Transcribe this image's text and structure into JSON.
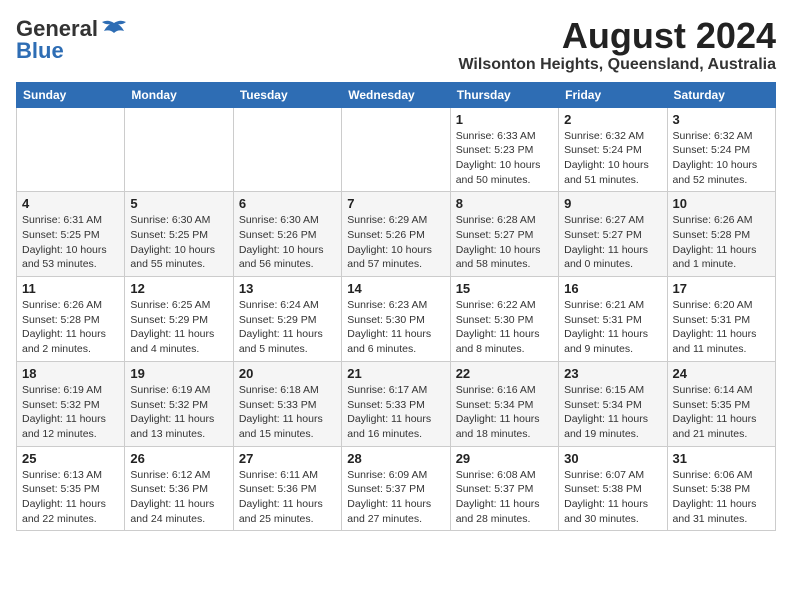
{
  "header": {
    "logo_general": "General",
    "logo_blue": "Blue",
    "month_year": "August 2024",
    "location": "Wilsonton Heights, Queensland, Australia"
  },
  "weekdays": [
    "Sunday",
    "Monday",
    "Tuesday",
    "Wednesday",
    "Thursday",
    "Friday",
    "Saturday"
  ],
  "weeks": [
    [
      {
        "day": "",
        "sunrise": "",
        "sunset": "",
        "daylight": ""
      },
      {
        "day": "",
        "sunrise": "",
        "sunset": "",
        "daylight": ""
      },
      {
        "day": "",
        "sunrise": "",
        "sunset": "",
        "daylight": ""
      },
      {
        "day": "",
        "sunrise": "",
        "sunset": "",
        "daylight": ""
      },
      {
        "day": "1",
        "sunrise": "Sunrise: 6:33 AM",
        "sunset": "Sunset: 5:23 PM",
        "daylight": "Daylight: 10 hours and 50 minutes."
      },
      {
        "day": "2",
        "sunrise": "Sunrise: 6:32 AM",
        "sunset": "Sunset: 5:24 PM",
        "daylight": "Daylight: 10 hours and 51 minutes."
      },
      {
        "day": "3",
        "sunrise": "Sunrise: 6:32 AM",
        "sunset": "Sunset: 5:24 PM",
        "daylight": "Daylight: 10 hours and 52 minutes."
      }
    ],
    [
      {
        "day": "4",
        "sunrise": "Sunrise: 6:31 AM",
        "sunset": "Sunset: 5:25 PM",
        "daylight": "Daylight: 10 hours and 53 minutes."
      },
      {
        "day": "5",
        "sunrise": "Sunrise: 6:30 AM",
        "sunset": "Sunset: 5:25 PM",
        "daylight": "Daylight: 10 hours and 55 minutes."
      },
      {
        "day": "6",
        "sunrise": "Sunrise: 6:30 AM",
        "sunset": "Sunset: 5:26 PM",
        "daylight": "Daylight: 10 hours and 56 minutes."
      },
      {
        "day": "7",
        "sunrise": "Sunrise: 6:29 AM",
        "sunset": "Sunset: 5:26 PM",
        "daylight": "Daylight: 10 hours and 57 minutes."
      },
      {
        "day": "8",
        "sunrise": "Sunrise: 6:28 AM",
        "sunset": "Sunset: 5:27 PM",
        "daylight": "Daylight: 10 hours and 58 minutes."
      },
      {
        "day": "9",
        "sunrise": "Sunrise: 6:27 AM",
        "sunset": "Sunset: 5:27 PM",
        "daylight": "Daylight: 11 hours and 0 minutes."
      },
      {
        "day": "10",
        "sunrise": "Sunrise: 6:26 AM",
        "sunset": "Sunset: 5:28 PM",
        "daylight": "Daylight: 11 hours and 1 minute."
      }
    ],
    [
      {
        "day": "11",
        "sunrise": "Sunrise: 6:26 AM",
        "sunset": "Sunset: 5:28 PM",
        "daylight": "Daylight: 11 hours and 2 minutes."
      },
      {
        "day": "12",
        "sunrise": "Sunrise: 6:25 AM",
        "sunset": "Sunset: 5:29 PM",
        "daylight": "Daylight: 11 hours and 4 minutes."
      },
      {
        "day": "13",
        "sunrise": "Sunrise: 6:24 AM",
        "sunset": "Sunset: 5:29 PM",
        "daylight": "Daylight: 11 hours and 5 minutes."
      },
      {
        "day": "14",
        "sunrise": "Sunrise: 6:23 AM",
        "sunset": "Sunset: 5:30 PM",
        "daylight": "Daylight: 11 hours and 6 minutes."
      },
      {
        "day": "15",
        "sunrise": "Sunrise: 6:22 AM",
        "sunset": "Sunset: 5:30 PM",
        "daylight": "Daylight: 11 hours and 8 minutes."
      },
      {
        "day": "16",
        "sunrise": "Sunrise: 6:21 AM",
        "sunset": "Sunset: 5:31 PM",
        "daylight": "Daylight: 11 hours and 9 minutes."
      },
      {
        "day": "17",
        "sunrise": "Sunrise: 6:20 AM",
        "sunset": "Sunset: 5:31 PM",
        "daylight": "Daylight: 11 hours and 11 minutes."
      }
    ],
    [
      {
        "day": "18",
        "sunrise": "Sunrise: 6:19 AM",
        "sunset": "Sunset: 5:32 PM",
        "daylight": "Daylight: 11 hours and 12 minutes."
      },
      {
        "day": "19",
        "sunrise": "Sunrise: 6:19 AM",
        "sunset": "Sunset: 5:32 PM",
        "daylight": "Daylight: 11 hours and 13 minutes."
      },
      {
        "day": "20",
        "sunrise": "Sunrise: 6:18 AM",
        "sunset": "Sunset: 5:33 PM",
        "daylight": "Daylight: 11 hours and 15 minutes."
      },
      {
        "day": "21",
        "sunrise": "Sunrise: 6:17 AM",
        "sunset": "Sunset: 5:33 PM",
        "daylight": "Daylight: 11 hours and 16 minutes."
      },
      {
        "day": "22",
        "sunrise": "Sunrise: 6:16 AM",
        "sunset": "Sunset: 5:34 PM",
        "daylight": "Daylight: 11 hours and 18 minutes."
      },
      {
        "day": "23",
        "sunrise": "Sunrise: 6:15 AM",
        "sunset": "Sunset: 5:34 PM",
        "daylight": "Daylight: 11 hours and 19 minutes."
      },
      {
        "day": "24",
        "sunrise": "Sunrise: 6:14 AM",
        "sunset": "Sunset: 5:35 PM",
        "daylight": "Daylight: 11 hours and 21 minutes."
      }
    ],
    [
      {
        "day": "25",
        "sunrise": "Sunrise: 6:13 AM",
        "sunset": "Sunset: 5:35 PM",
        "daylight": "Daylight: 11 hours and 22 minutes."
      },
      {
        "day": "26",
        "sunrise": "Sunrise: 6:12 AM",
        "sunset": "Sunset: 5:36 PM",
        "daylight": "Daylight: 11 hours and 24 minutes."
      },
      {
        "day": "27",
        "sunrise": "Sunrise: 6:11 AM",
        "sunset": "Sunset: 5:36 PM",
        "daylight": "Daylight: 11 hours and 25 minutes."
      },
      {
        "day": "28",
        "sunrise": "Sunrise: 6:09 AM",
        "sunset": "Sunset: 5:37 PM",
        "daylight": "Daylight: 11 hours and 27 minutes."
      },
      {
        "day": "29",
        "sunrise": "Sunrise: 6:08 AM",
        "sunset": "Sunset: 5:37 PM",
        "daylight": "Daylight: 11 hours and 28 minutes."
      },
      {
        "day": "30",
        "sunrise": "Sunrise: 6:07 AM",
        "sunset": "Sunset: 5:38 PM",
        "daylight": "Daylight: 11 hours and 30 minutes."
      },
      {
        "day": "31",
        "sunrise": "Sunrise: 6:06 AM",
        "sunset": "Sunset: 5:38 PM",
        "daylight": "Daylight: 11 hours and 31 minutes."
      }
    ]
  ]
}
